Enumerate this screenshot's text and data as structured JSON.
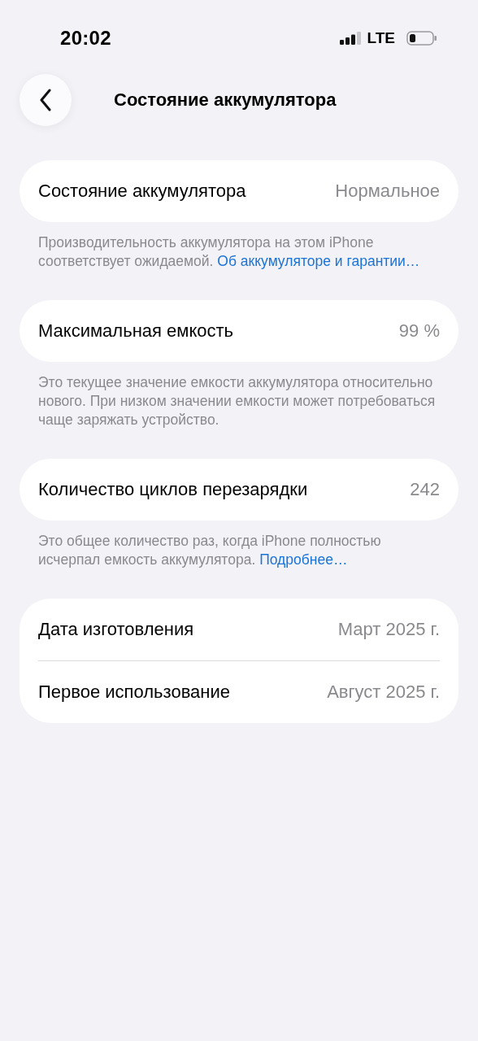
{
  "status_bar": {
    "time": "20:02",
    "network": "LTE"
  },
  "nav": {
    "title": "Состояние аккумулятора"
  },
  "sections": [
    {
      "rows": [
        {
          "label": "Состояние аккумулятора",
          "value": "Нормальное"
        }
      ],
      "footer": {
        "text": "Производительность аккумулятора на этом iPhone соответствует ожидаемой.",
        "link": "Об аккумуляторе и гарантии…"
      }
    },
    {
      "rows": [
        {
          "label": "Максимальная емкость",
          "value": "99 %"
        }
      ],
      "footer": {
        "text": "Это текущее значение емкости аккумулятора относительно нового. При низком значении емкости может потребоваться чаще заряжать устройство."
      }
    },
    {
      "rows": [
        {
          "label": "Количество циклов перезарядки",
          "value": "242"
        }
      ],
      "footer": {
        "text": "Это общее количество раз, когда iPhone полностью исчерпал емкость аккумулятора.",
        "link": "Подробнее…"
      }
    },
    {
      "rows": [
        {
          "label": "Дата изготовления",
          "value": "Март 2025 г."
        },
        {
          "label": "Первое использование",
          "value": "Август 2025 г."
        }
      ]
    }
  ]
}
